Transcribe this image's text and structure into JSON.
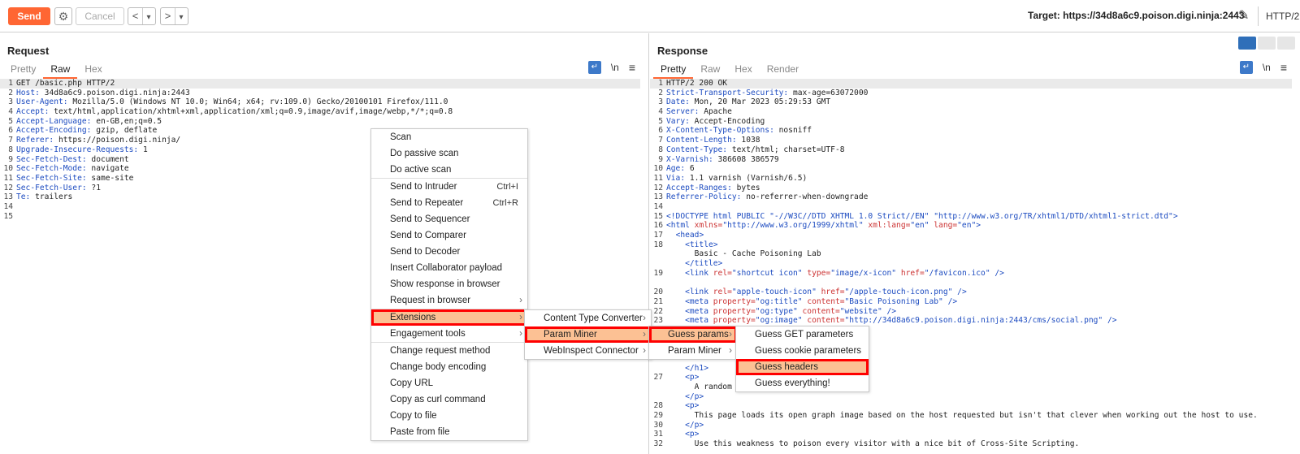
{
  "toolbar": {
    "send_label": "Send",
    "cancel_label": "Cancel",
    "back_glyph": "<",
    "forward_glyph": ">",
    "dropdown_glyph": "▾",
    "target_text": "Target: https://34d8a6c9.poison.digi.ninja:2443",
    "protocol": "HTTP/2",
    "accent_color": "#ff6633"
  },
  "request": {
    "title": "Request",
    "tabs": [
      "Pretty",
      "Raw",
      "Hex"
    ],
    "active_tab": "Raw",
    "icon_newline": "\\n",
    "lines": [
      {
        "n": "1",
        "key": "",
        "text": "GET /basic.php HTTP/2"
      },
      {
        "n": "2",
        "key": "Host:",
        "text": " 34d8a6c9.poison.digi.ninja:2443"
      },
      {
        "n": "3",
        "key": "User-Agent:",
        "text": " Mozilla/5.0 (Windows NT 10.0; Win64; x64; rv:109.0) Gecko/20100101 Firefox/111.0"
      },
      {
        "n": "4",
        "key": "Accept:",
        "text": " text/html,application/xhtml+xml,application/xml;q=0.9,image/avif,image/webp,*/*;q=0.8"
      },
      {
        "n": "5",
        "key": "Accept-Language:",
        "text": " en-GB,en;q=0.5"
      },
      {
        "n": "6",
        "key": "Accept-Encoding:",
        "text": " gzip, deflate"
      },
      {
        "n": "7",
        "key": "Referer:",
        "text": " https://poison.digi.ninja/"
      },
      {
        "n": "8",
        "key": "Upgrade-Insecure-Requests:",
        "text": " 1"
      },
      {
        "n": "9",
        "key": "Sec-Fetch-Dest:",
        "text": " document"
      },
      {
        "n": "10",
        "key": "Sec-Fetch-Mode:",
        "text": " navigate"
      },
      {
        "n": "11",
        "key": "Sec-Fetch-Site:",
        "text": " same-site"
      },
      {
        "n": "12",
        "key": "Sec-Fetch-User:",
        "text": " ?1"
      },
      {
        "n": "13",
        "key": "Te:",
        "text": " trailers"
      },
      {
        "n": "14",
        "key": "",
        "text": ""
      },
      {
        "n": "15",
        "key": "",
        "text": ""
      }
    ]
  },
  "response": {
    "title": "Response",
    "tabs": [
      "Pretty",
      "Raw",
      "Hex",
      "Render"
    ],
    "active_tab": "Pretty",
    "icon_newline": "\\n",
    "lines": [
      {
        "n": "1",
        "html": "HTTP/2 200 OK"
      },
      {
        "n": "2",
        "html": "<span class='hk'>Strict-Transport-Security:</span> max-age=63072000"
      },
      {
        "n": "3",
        "html": "<span class='hk'>Date:</span> Mon, 20 Mar 2023 05:29:53 GMT"
      },
      {
        "n": "4",
        "html": "<span class='hk'>Server:</span> Apache"
      },
      {
        "n": "5",
        "html": "<span class='hk'>Vary:</span> Accept-Encoding"
      },
      {
        "n": "6",
        "html": "<span class='hk'>X-Content-Type-Options:</span> nosniff"
      },
      {
        "n": "7",
        "html": "<span class='hk'>Content-Length:</span> 1038"
      },
      {
        "n": "8",
        "html": "<span class='hk'>Content-Type:</span> text/html; charset=UTF-8"
      },
      {
        "n": "9",
        "html": "<span class='hk'>X-Varnish:</span> 386608 386579"
      },
      {
        "n": "10",
        "html": "<span class='hk'>Age:</span> 6"
      },
      {
        "n": "11",
        "html": "<span class='hk'>Via:</span> 1.1 varnish (Varnish/6.5)"
      },
      {
        "n": "12",
        "html": "<span class='hk'>Accept-Ranges:</span> bytes"
      },
      {
        "n": "13",
        "html": "<span class='hk'>Referrer-Policy:</span> no-referrer-when-downgrade"
      },
      {
        "n": "14",
        "html": ""
      },
      {
        "n": "15",
        "html": "<span class='tag'>&lt;!DOCTYPE html PUBLIC</span> <span class='str'>\"-//W3C//DTD XHTML 1.0 Strict//EN\"</span> <span class='str'>\"http://www.w3.org/TR/xhtml1/DTD/xhtml1-strict.dtd\"</span><span class='tag'>&gt;</span>"
      },
      {
        "n": "16",
        "html": "<span class='tag'>&lt;html</span> <span class='attr'>xmlns=</span><span class='str'>\"http://www.w3.org/1999/xhtml\"</span> <span class='attr'>xml:lang=</span><span class='str'>\"en\"</span> <span class='attr'>lang=</span><span class='str'>\"en\"</span><span class='tag'>&gt;</span>"
      },
      {
        "n": "17",
        "html": "  <span class='tag'>&lt;head&gt;</span>"
      },
      {
        "n": "18",
        "html": "    <span class='tag'>&lt;title&gt;</span>"
      },
      {
        "n": "",
        "html": "      Basic - Cache Poisoning Lab"
      },
      {
        "n": "",
        "html": "    <span class='tag'>&lt;/title&gt;</span>"
      },
      {
        "n": "19",
        "html": "    <span class='tag'>&lt;link</span> <span class='attr'>rel=</span><span class='str'>\"shortcut icon\"</span> <span class='attr'>type=</span><span class='str'>\"image/x-icon\"</span> <span class='attr'>href=</span><span class='str'>\"/favicon.ico\"</span> <span class='tag'>/&gt;</span>"
      },
      {
        "n": "",
        "html": ""
      },
      {
        "n": "20",
        "html": "    <span class='tag'>&lt;link</span> <span class='attr'>rel=</span><span class='str'>\"apple-touch-icon\"</span> <span class='attr'>href=</span><span class='str'>\"/apple-touch-icon.png\"</span> <span class='tag'>/&gt;</span>"
      },
      {
        "n": "21",
        "html": "    <span class='tag'>&lt;meta</span> <span class='attr'>property=</span><span class='str'>\"og:title\"</span> <span class='attr'>content=</span><span class='str'>\"Basic Poisoning Lab\"</span> <span class='tag'>/&gt;</span>"
      },
      {
        "n": "22",
        "html": "    <span class='tag'>&lt;meta</span> <span class='attr'>property=</span><span class='str'>\"og:type\"</span> <span class='attr'>content=</span><span class='str'>\"website\"</span> <span class='tag'>/&gt;</span>"
      },
      {
        "n": "23",
        "html": "    <span class='tag'>&lt;meta</span> <span class='attr'>property=</span><span class='str'>\"og:image\"</span> <span class='attr'>content=</span><span class='str'>\"http://34d8a6c9.poison.digi.ninja:2443/cms/social.png\"</span> <span class='tag'>/&gt;</span>"
      },
      {
        "n": "",
        "html": ""
      },
      {
        "n": "",
        "html": ""
      },
      {
        "n": "",
        "html": ""
      },
      {
        "n": "",
        "html": ""
      },
      {
        "n": "",
        "html": "    <span class='tag'>&lt;/h1&gt;</span>"
      },
      {
        "n": "27",
        "html": "    <span class='tag'>&lt;p&gt;</span>"
      },
      {
        "n": "",
        "html": "      A random nu"
      },
      {
        "n": "",
        "html": "    <span class='tag'>&lt;/p&gt;</span>"
      },
      {
        "n": "28",
        "html": "    <span class='tag'>&lt;p&gt;</span>"
      },
      {
        "n": "29",
        "html": "      This page loads its open graph image based on the host requested but isn't that clever when working out the host to use."
      },
      {
        "n": "30",
        "html": "    <span class='tag'>&lt;/p&gt;</span>"
      },
      {
        "n": "31",
        "html": "    <span class='tag'>&lt;p&gt;</span>"
      },
      {
        "n": "32",
        "html": "      Use this weakness to poison every visitor with a nice bit of Cross-Site Scripting."
      }
    ]
  },
  "context_menu": {
    "items": [
      {
        "label": "Scan",
        "shortcut": "",
        "submenu": false
      },
      {
        "label": "Do passive scan",
        "shortcut": "",
        "submenu": false
      },
      {
        "label": "Do active scan",
        "shortcut": "",
        "submenu": false,
        "sep_after": true
      },
      {
        "label": "Send to Intruder",
        "shortcut": "Ctrl+I",
        "submenu": false
      },
      {
        "label": "Send to Repeater",
        "shortcut": "Ctrl+R",
        "submenu": false
      },
      {
        "label": "Send to Sequencer",
        "shortcut": "",
        "submenu": false
      },
      {
        "label": "Send to Comparer",
        "shortcut": "",
        "submenu": false
      },
      {
        "label": "Send to Decoder",
        "shortcut": "",
        "submenu": false
      },
      {
        "label": "Insert Collaborator payload",
        "shortcut": "",
        "submenu": false
      },
      {
        "label": "Show response in browser",
        "shortcut": "",
        "submenu": false
      },
      {
        "label": "Request in browser",
        "shortcut": "",
        "submenu": true,
        "sep_after": true
      },
      {
        "label": "Extensions",
        "shortcut": "",
        "submenu": true,
        "highlight": true,
        "redbox": true
      },
      {
        "label": "Engagement tools",
        "shortcut": "",
        "submenu": true,
        "sep_after": true
      },
      {
        "label": "Change request method",
        "shortcut": "",
        "submenu": false
      },
      {
        "label": "Change body encoding",
        "shortcut": "",
        "submenu": false
      },
      {
        "label": "Copy URL",
        "shortcut": "",
        "submenu": false
      },
      {
        "label": "Copy as curl command",
        "shortcut": "",
        "submenu": false
      },
      {
        "label": "Copy to file",
        "shortcut": "",
        "submenu": false
      },
      {
        "label": "Paste from file",
        "shortcut": "",
        "submenu": false
      }
    ]
  },
  "extensions_menu": {
    "items": [
      {
        "label": "Content Type Converter",
        "submenu": true
      },
      {
        "label": "Param Miner",
        "submenu": true,
        "highlight": true,
        "redbox": true
      },
      {
        "label": "WebInspect Connector",
        "submenu": true
      }
    ]
  },
  "param_miner_menu": {
    "items": [
      {
        "label": "Guess params",
        "submenu": true,
        "highlight": true,
        "redbox": true
      },
      {
        "label": "Param Miner",
        "submenu": true
      }
    ]
  },
  "guess_params_menu": {
    "items": [
      {
        "label": "Guess GET parameters"
      },
      {
        "label": "Guess cookie parameters"
      },
      {
        "label": "Guess headers",
        "highlight": true,
        "redbox": true
      },
      {
        "label": "Guess everything!"
      }
    ]
  }
}
